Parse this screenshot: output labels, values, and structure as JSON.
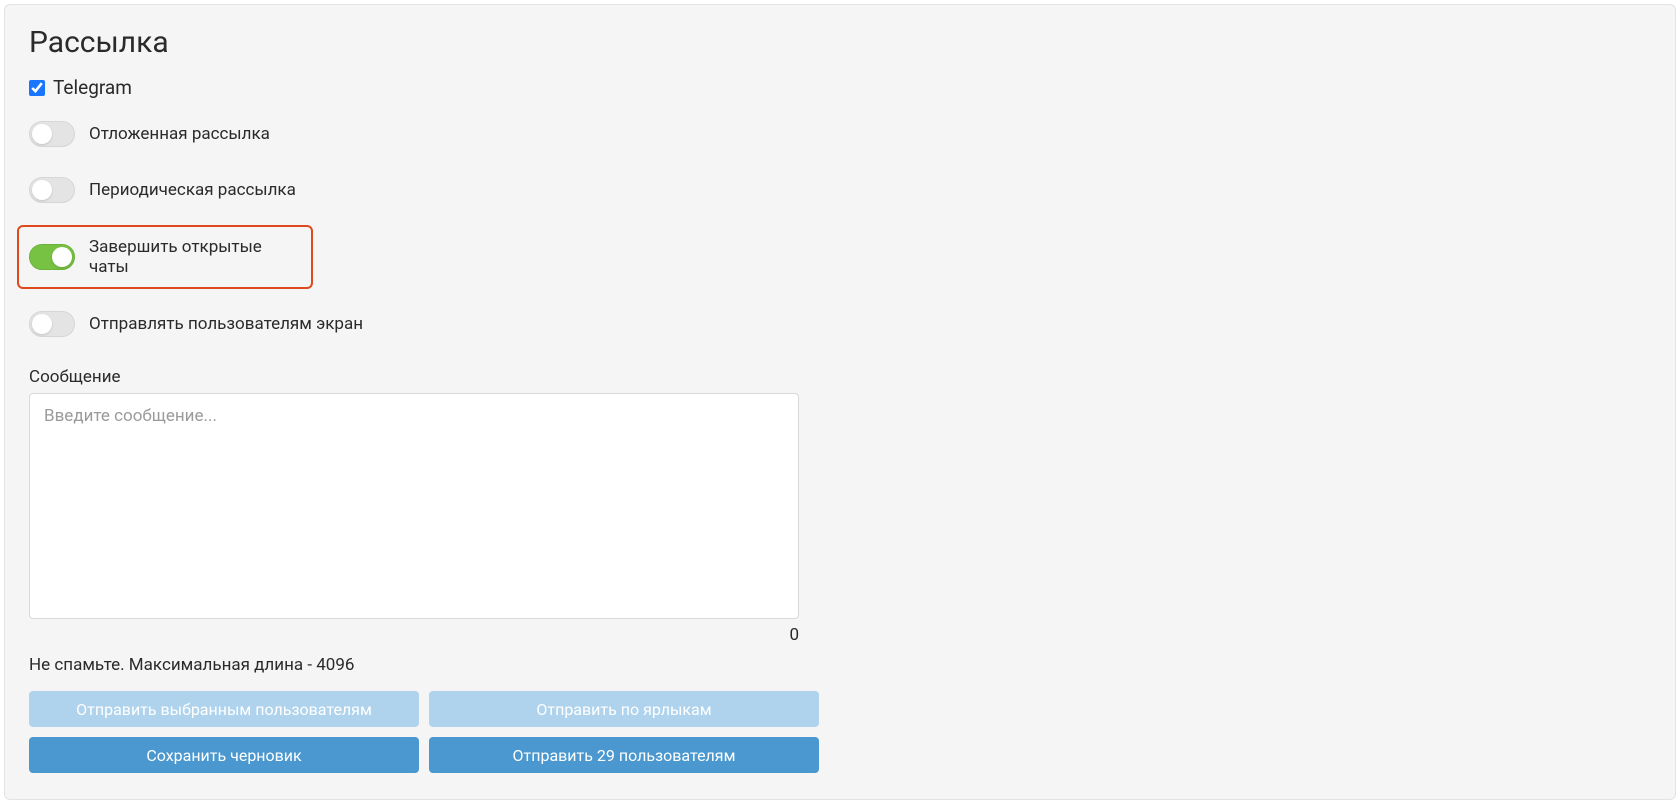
{
  "title": "Рассылка",
  "checkbox": {
    "telegram_label": "Telegram",
    "telegram_checked": true
  },
  "toggles": {
    "delayed": {
      "label": "Отложенная рассылка",
      "on": false
    },
    "periodic": {
      "label": "Периодическая рассылка",
      "on": false
    },
    "close_chats": {
      "label": "Завершить открытые чаты",
      "on": true
    },
    "send_screen": {
      "label": "Отправлять пользователям экран",
      "on": false
    }
  },
  "message": {
    "label": "Сообщение",
    "placeholder": "Введите сообщение...",
    "value": "",
    "counter": "0",
    "hint": "Не спамьте. Максимальная длина - 4096"
  },
  "buttons": {
    "send_selected": "Отправить выбранным пользователям",
    "send_by_labels": "Отправить по ярлыкам",
    "save_draft": "Сохранить черновик",
    "send_to_users": "Отправить 29 пользователям"
  }
}
